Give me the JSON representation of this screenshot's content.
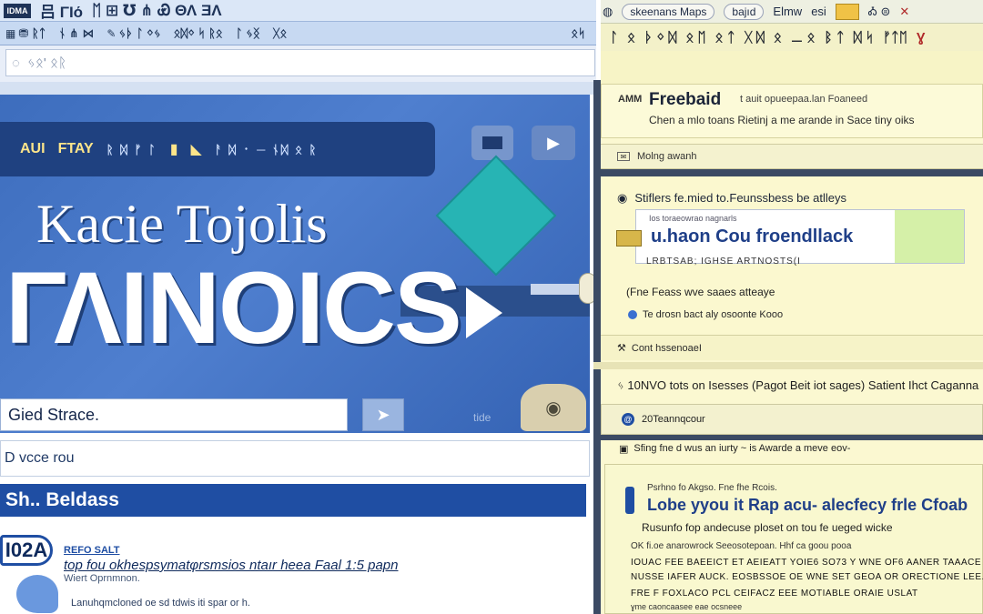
{
  "menubar": {
    "items": [
      "吕 ΓΙό",
      "ᛖ ⊞ ℧ ⋔ Ꮿ ΘΛ ƎΛ"
    ]
  },
  "toolbar": {
    "buttons": [
      "⛃ ᚱᛏ",
      "ᚾ ⋔ ⋈",
      "ᛃᚦ ᛚ ᛜᛃ",
      "ᛟᛞᛜ ᛋ ᚱᛟ",
      "ᛚ ᛃᛝ",
      "ᚷᛟ"
    ],
    "end": "ᛟᛋ"
  },
  "address": {
    "placeholder": "ᛃᛟ' ᛟᚱ"
  },
  "hero": {
    "bar_left": "AUI",
    "bar_accent": "FTAY",
    "bar_rest": "ᚱ ᛞ ᚠ ᛚ",
    "title1": "Kacie Tojolis",
    "title2": "ΓΛINOICS",
    "search_value": "Gied Strace.",
    "search_btn_icon": "send-icon",
    "tag": "tide"
  },
  "filter": {
    "value": "D vcce rou"
  },
  "section": {
    "title": "Sh.. Beldass"
  },
  "item": {
    "badge": "I02A",
    "tag": "REFO SALT",
    "title": "top fou okhespsymatφrsmsios ntaır heea Faal 1:5 papn",
    "sub": "Wiert Oprnmnon.",
    "sub2": "Lanuhqmcloned oe sd tdwis iti spar or h."
  },
  "right": {
    "topbar": {
      "label1": "skeenans Maps",
      "label2": "bajıd",
      "label3": "Elmw",
      "label4": "esi",
      "label5": "Ꭳ ⊜"
    },
    "tools": [
      "ᛚ",
      "ᛟ",
      "ᚦ ᛜ ᛞ",
      "ᛟ ᛖ",
      "ᛟ ᛏ",
      "ᚷ ᛞ",
      "ᛟ",
      "⚊ ᛟ",
      "ᛒ ᛏ",
      "ᛞ ᛋ",
      "ᛟ",
      "ᚠᛏᛖ",
      "ᛟ"
    ],
    "close": "Ɣ",
    "card1": {
      "amount": "AMM",
      "title": "Freebaid",
      "meta": "t auit opueepaa.lan Foaneed",
      "line": "Chen a mlo toans Rietinj a me arande in Sace tiny oiks"
    },
    "more": "Molng awanh",
    "card2": {
      "head": "Stiflers fe.mied to.Feunssbess be atlleys",
      "box_small": "Ios toraeowrao nagnarls",
      "box_big": "u.haon Cou froendllack",
      "caption": "LRBTSAB; IGHSE ARTNOSTS(I",
      "line1": "(Fne Feass wve saaes atteaye",
      "line2": "Te drosn bact aly osoonte Kooo"
    },
    "connect": "Cont hssenoaeI",
    "row1": "ᛃ 10NVO tots on Isesses (Pagot Beit iot sages) Satient Ihct Caganna",
    "row2": "20Teannqcour",
    "row3": "Sfing fne d wus an iurty ~ is Awarde a meve eov-",
    "card3": {
      "tag": "Psrhno fo Akgso. Fne fhe Rcois.",
      "title": "Lobe yyou it Rap acu- alecfecy frle Cfoab",
      "sub": "Rusunfo fop andecuse ploset on tou fe ueged wicke",
      "meta": "OK fi.oe anarowrock Seeosotepoan. Hhf ca goou pooa",
      "p1": "IOUAC FEE BAEEICT ET AEIEATT YOIE6 SO73 Y WNE OF6 AANER TAAACE",
      "p2": "NUSSE IAFER AUCK. EOSBSSOE OE WNE SET GEOA OR ORECTIONE LEE.",
      "p3": "FRE F FOXLACO PCL CEIFACZ EEE MOTIABLE ORAIE USLAT",
      "p4": "ɣme caoncaasee eae ocsneee"
    }
  }
}
